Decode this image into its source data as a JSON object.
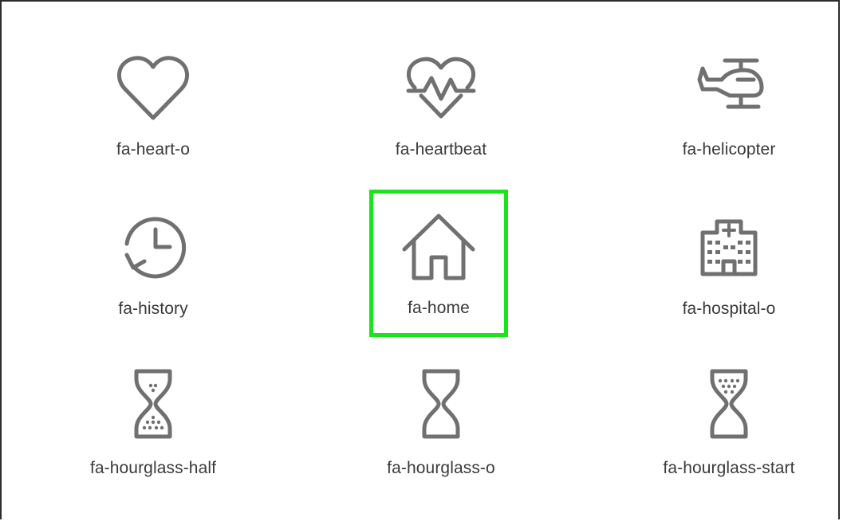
{
  "colors": {
    "icon_stroke": "#707070",
    "label_text": "#3a3a3a",
    "selection_border": "#19e619",
    "frame_border": "#2b2b2b",
    "background": "#ffffff"
  },
  "icons": [
    {
      "id": "heart-o",
      "label": "fa-heart-o",
      "icon": "heart-outline-icon",
      "selected": false
    },
    {
      "id": "heartbeat",
      "label": "fa-heartbeat",
      "icon": "heartbeat-icon",
      "selected": false
    },
    {
      "id": "helicopter",
      "label": "fa-helicopter",
      "icon": "helicopter-icon",
      "selected": false
    },
    {
      "id": "history",
      "label": "fa-history",
      "icon": "history-icon",
      "selected": false
    },
    {
      "id": "home",
      "label": "fa-home",
      "icon": "home-icon",
      "selected": true
    },
    {
      "id": "hospital-o",
      "label": "fa-hospital-o",
      "icon": "hospital-icon",
      "selected": false
    },
    {
      "id": "hourglass-half",
      "label": "fa-hourglass-half",
      "icon": "hourglass-half-icon",
      "selected": false
    },
    {
      "id": "hourglass-o",
      "label": "fa-hourglass-o",
      "icon": "hourglass-outline-icon",
      "selected": false
    },
    {
      "id": "hourglass-start",
      "label": "fa-hourglass-start",
      "icon": "hourglass-start-icon",
      "selected": false
    }
  ]
}
